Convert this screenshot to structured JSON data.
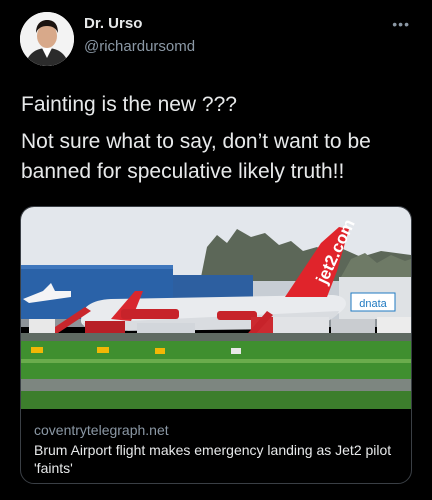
{
  "author": {
    "display_name": "Dr. Urso",
    "handle": "@richardursomd"
  },
  "tweet": {
    "lines": [
      "Fainting is the new ???",
      "Not sure what to say, don’t want to be banned for speculative likely truth!!"
    ]
  },
  "more_icon": "more-horizontal-icon",
  "link_card": {
    "domain": "coventrytelegraph.net",
    "title": "Brum Airport flight makes emergency landing as Jet2 pilot 'faints'",
    "photo_text": {
      "tail": "jet2.com",
      "hangar": "dnata"
    }
  },
  "colors": {
    "background": "#000000",
    "text_primary": "#e7e9ea",
    "text_secondary": "#8b98a5",
    "card_border": "#3a3f45",
    "jet2_red": "#e0242b"
  }
}
